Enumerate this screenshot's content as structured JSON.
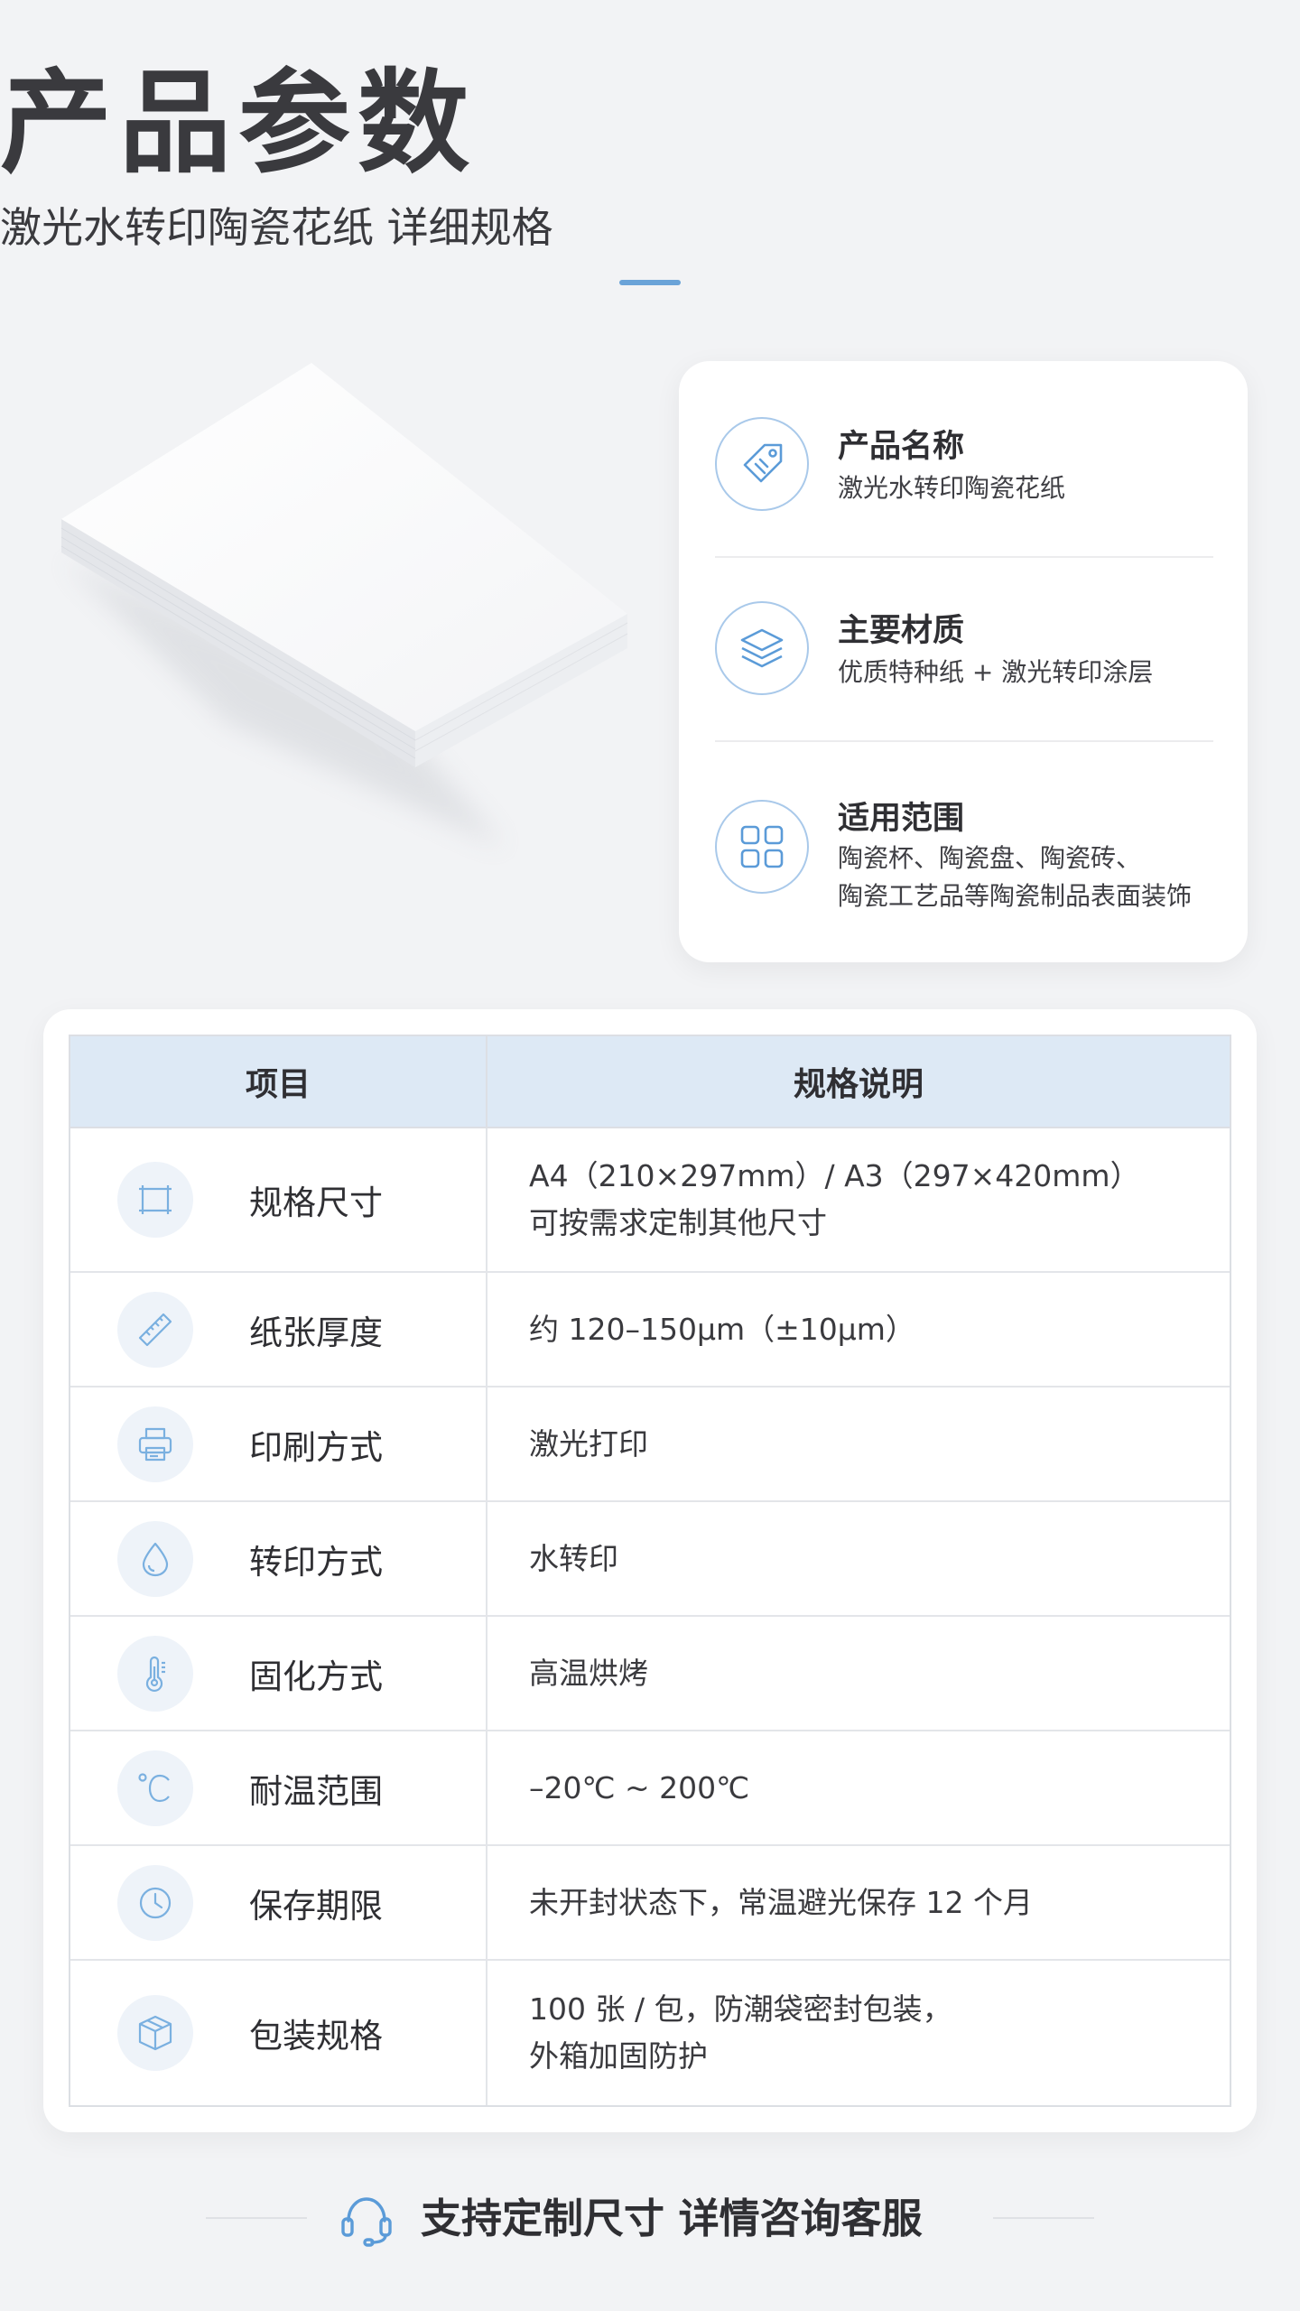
{
  "header": {
    "title": "产品参数",
    "subtitle": "激光水转印陶瓷花纸 详细规格"
  },
  "info_card": {
    "items": [
      {
        "icon": "tag-icon",
        "title": "产品名称",
        "desc": "激光水转印陶瓷花纸"
      },
      {
        "icon": "layers-icon",
        "title": "主要材质",
        "desc": "优质特种纸 + 激光转印涂层"
      },
      {
        "icon": "grid-icon",
        "title": "适用范围",
        "desc": "陶瓷杯、陶瓷盘、陶瓷砖、\n陶瓷工艺品等陶瓷制品表面装饰"
      }
    ]
  },
  "table": {
    "headers": [
      "项目",
      "规格说明"
    ],
    "rows": [
      {
        "icon": "frame-size-icon",
        "label": "规格尺寸",
        "value": "A4（210×297mm）/ A3（297×420mm）\n可按需求定制其他尺寸"
      },
      {
        "icon": "ruler-icon",
        "label": "纸张厚度",
        "value": "约 120–150μm（±10μm）"
      },
      {
        "icon": "printer-icon",
        "label": "印刷方式",
        "value": "激光打印"
      },
      {
        "icon": "water-drop-icon",
        "label": "转印方式",
        "value": "水转印"
      },
      {
        "icon": "thermometer-icon",
        "label": "固化方式",
        "value": "高温烘烤"
      },
      {
        "icon": "celsius-icon",
        "label": "耐温范围",
        "value": "–20℃ ~ 200℃"
      },
      {
        "icon": "clock-icon",
        "label": "保存期限",
        "value": "未开封状态下，常温避光保存 12 个月"
      },
      {
        "icon": "package-box-icon",
        "label": "包装规格",
        "value": "100 张 / 包，防潮袋密封包装，\n外箱加固防护"
      }
    ]
  },
  "footer": {
    "icon": "headset-icon",
    "text": "支持定制尺寸 详情咨询客服"
  },
  "colors": {
    "accent": "#6aa3d8",
    "table_header_bg": "#dde9f5",
    "background": "#f2f3f5"
  }
}
